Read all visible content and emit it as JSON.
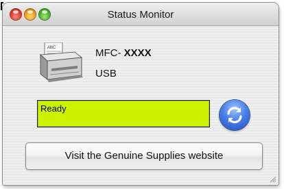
{
  "window": {
    "title": "Status Monitor"
  },
  "device": {
    "model_prefix": "MFC- ",
    "model_name": "XXXX",
    "connection": "USB"
  },
  "status": {
    "text": "Ready",
    "color": "#ccf200"
  },
  "actions": {
    "supplies_label": "Visit the Genuine Supplies website"
  },
  "icons": {
    "printer": "printer-icon",
    "refresh": "refresh-icon"
  }
}
